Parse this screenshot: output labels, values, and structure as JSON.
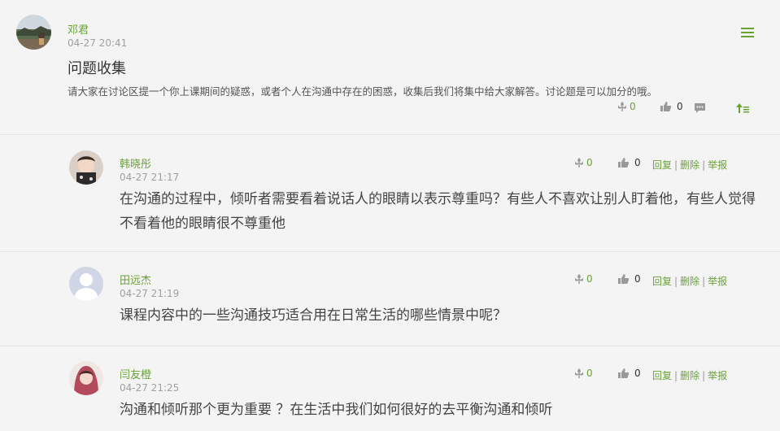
{
  "post": {
    "author": "邓君",
    "time": "04-27 20:41",
    "title": "问题收集",
    "body": "请大家在讨论区提一个你上课期间的疑惑，或者个人在沟通中存在的困惑，收集后我们将集中给大家解答。讨论题是可以加分的哦。",
    "flower_count": "0",
    "like_count": "0",
    "icons": {
      "menu": "menu-icon",
      "flower": "flower-icon",
      "like": "thumbs-up-icon",
      "comment": "comment-icon",
      "top": "pin-top-icon"
    }
  },
  "reply_actions": {
    "reply": "回复",
    "delete": "删除",
    "report": "举报",
    "sep": "|"
  },
  "replies": [
    {
      "author": "韩晓彤",
      "time": "04-27 21:17",
      "content": "在沟通的过程中，倾听者需要看着说话人的眼睛以表示尊重吗？有些人不喜欢让别人盯着他，有些人觉得不看着他的眼睛很不尊重他",
      "flower_count": "0",
      "like_count": "0"
    },
    {
      "author": "田远杰",
      "time": "04-27 21:19",
      "content": "课程内容中的一些沟通技巧适合用在日常生活的哪些情景中呢？",
      "flower_count": "0",
      "like_count": "0"
    },
    {
      "author": "闫友橙",
      "time": "04-27 21:25",
      "content": "沟通和倾听那个更为重要 ？在生活中我们如何很好的去平衡沟通和倾听",
      "flower_count": "0",
      "like_count": "0"
    }
  ],
  "colors": {
    "accent": "#6aa237",
    "background": "#f4f4f4",
    "divider": "#e3e3e3",
    "muted": "#a0a0a0"
  }
}
